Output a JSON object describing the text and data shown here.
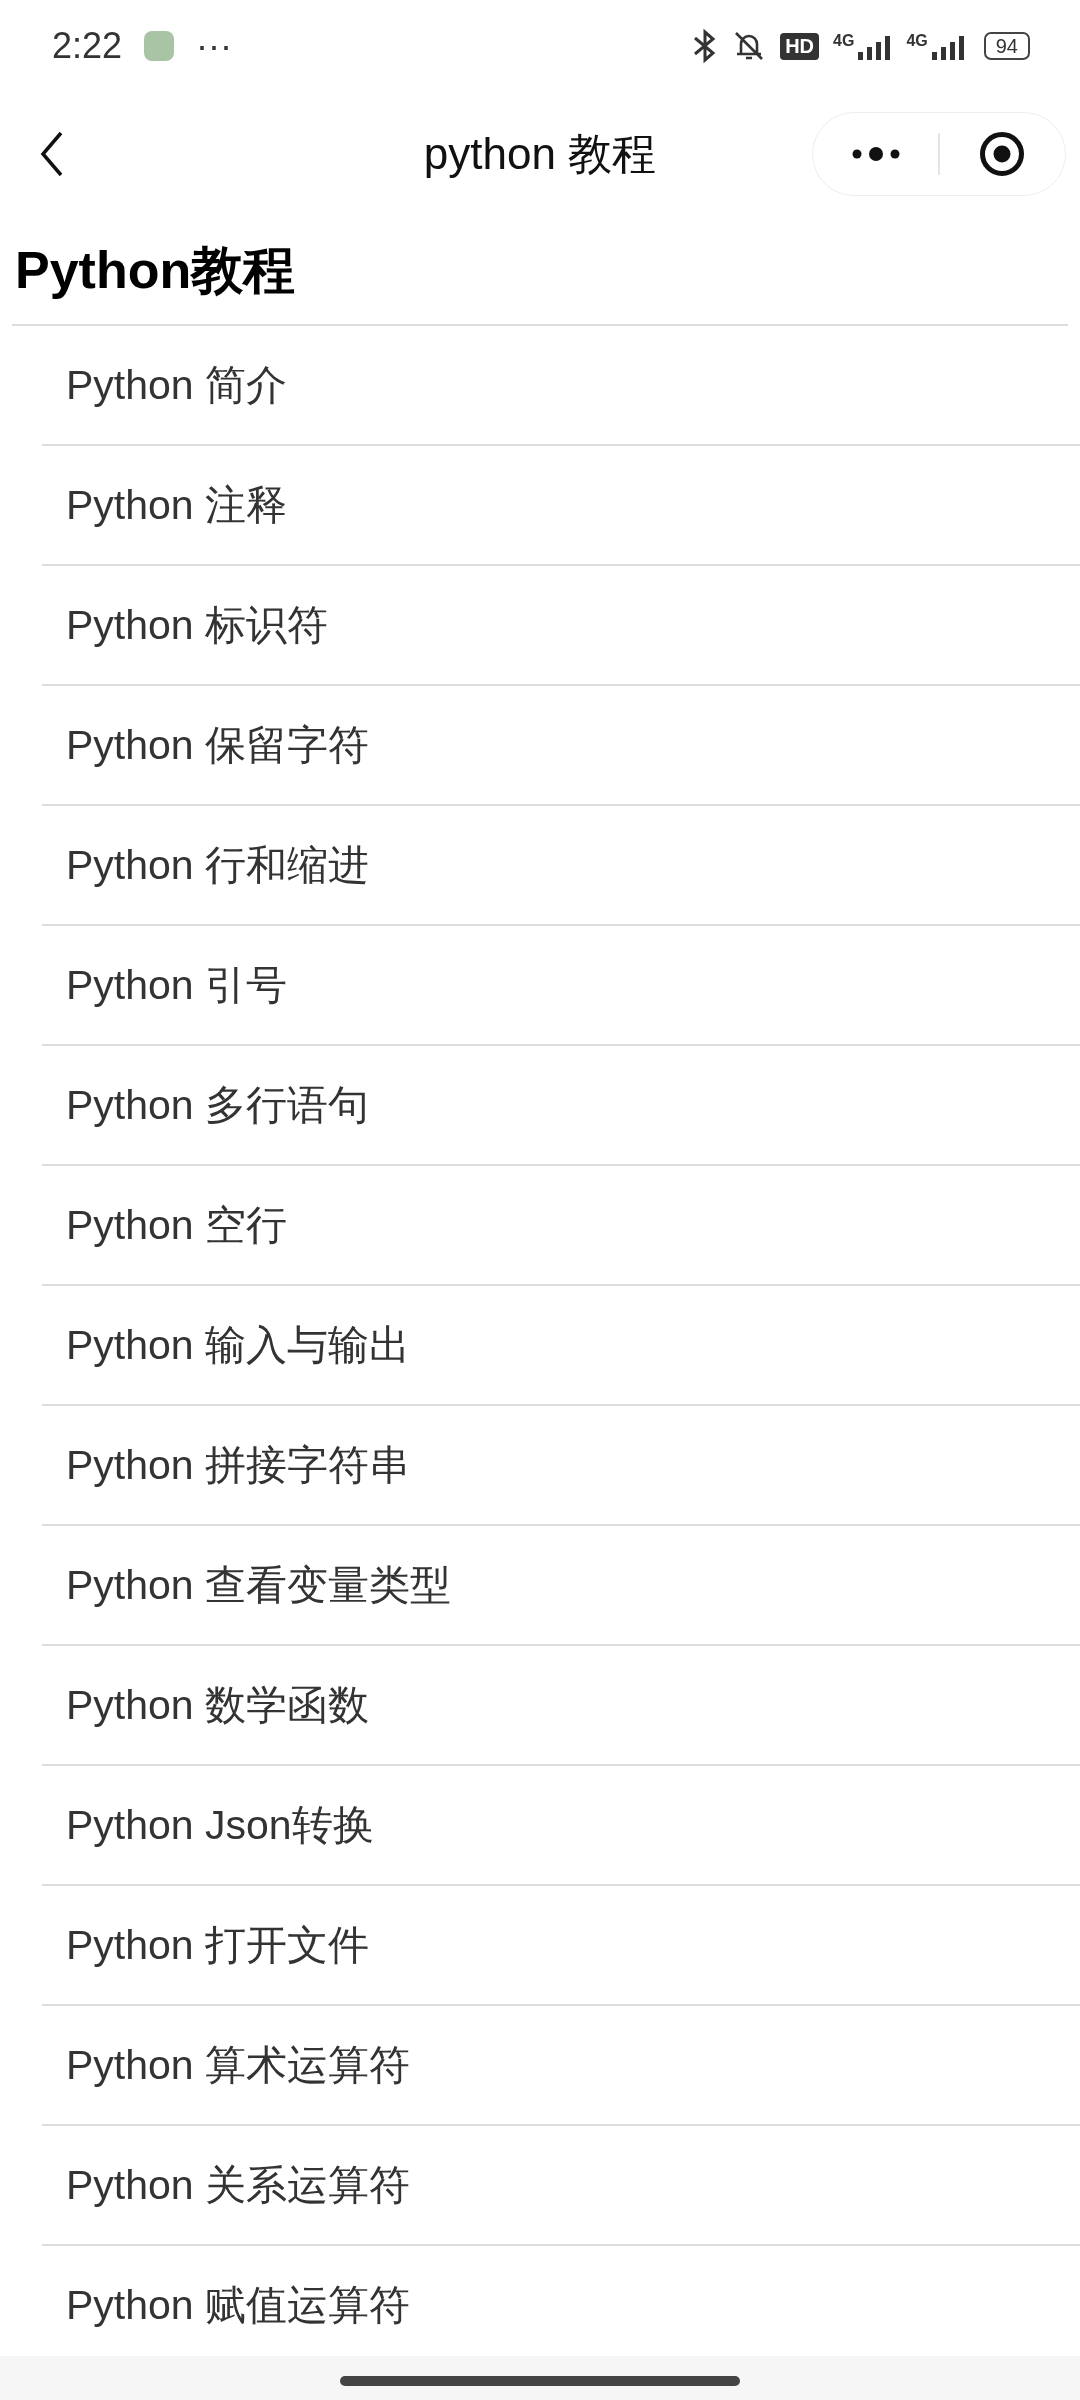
{
  "status_bar": {
    "time": "2:22",
    "more": "···",
    "hd": "HD",
    "networks": [
      "4G",
      "4G"
    ],
    "battery": "94"
  },
  "nav_bar": {
    "title": "python 教程"
  },
  "heading": "Python教程",
  "items": [
    {
      "label": "Python 简介"
    },
    {
      "label": "Python 注释"
    },
    {
      "label": "Python 标识符"
    },
    {
      "label": "Python 保留字符"
    },
    {
      "label": "Python 行和缩进"
    },
    {
      "label": "Python 引号"
    },
    {
      "label": "Python 多行语句"
    },
    {
      "label": "Python 空行"
    },
    {
      "label": "Python 输入与输出"
    },
    {
      "label": "Python 拼接字符串"
    },
    {
      "label": "Python 查看变量类型"
    },
    {
      "label": "Python 数学函数"
    },
    {
      "label": "Python Json转换"
    },
    {
      "label": "Python 打开文件"
    },
    {
      "label": "Python 算术运算符"
    },
    {
      "label": "Python 关系运算符"
    },
    {
      "label": "Python 赋值运算符"
    }
  ]
}
